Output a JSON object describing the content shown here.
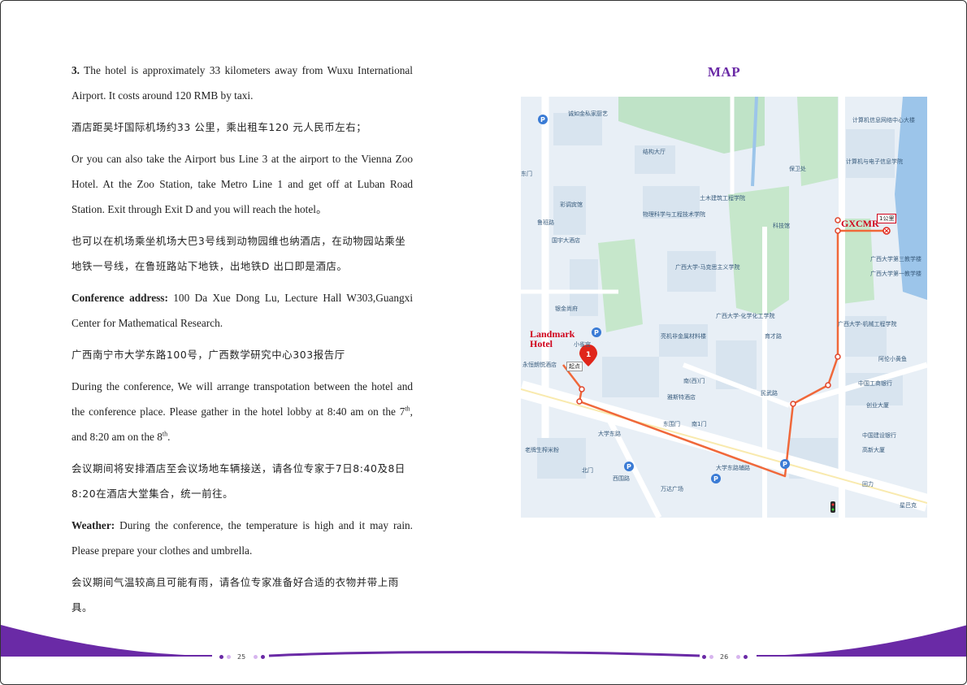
{
  "left": {
    "p1_bold": "3.",
    "p1_text": " The hotel is approximately 33 kilometers away from Wuxu International Airport. It costs around 120 RMB by taxi.",
    "p2_cn": "酒店距吴圩国际机场约33  公里，乘出租车120  元人民币左右；",
    "p3_text": "Or you can also take the Airport bus Line 3 at the airport to the Vienna Zoo Hotel. At the Zoo Station, take Metro Line 1 and get off at Luban Road Station. Exit through Exit D and you will reach the hotel。",
    "p4_cn": "也可以在机场乘坐机场大巴3号线到动物园维也纳酒店，在动物园站乘坐地铁一号线，在鲁班路站下地铁，出地铁D  出口即是酒店。",
    "p5_bold": "Conference address:",
    "p5_text": " 100 Da Xue Dong Lu, Lecture Hall W303,Guangxi Center for Mathematical Research.",
    "p6_cn": "广西南宁市大学东路100号，广西数学研究中心303报告厅",
    "p7_a": "During the conference, We will arrange transpotation between the hotel and the conference place. Please gather in the hotel lobby at 8:40 am on the 7",
    "p7_sup1": "th",
    "p7_b": ", and 8:20 am on the 8",
    "p7_sup2": "th",
    "p7_c": ".",
    "p8_cn": "会议期间将安排酒店至会议场地车辆接送，请各位专家于7日8:40及8日8:20在酒店大堂集合，统一前往。",
    "p9_bold": "Weather:",
    "p9_text": " During the conference, the temperature is high and it may rain. Please prepare your clothes and umbrella.",
    "p10_cn": "会议期间气温较高且可能有雨，请各位专家准备好合适的衣物并带上雨具。"
  },
  "map": {
    "title": "MAP",
    "hotel_label_1": "Landmark",
    "hotel_label_2": "Hotel",
    "dest_label": "GXCMR",
    "distance_label": "1公里",
    "start_label": "起点",
    "start_number": "1",
    "places": [
      "诚如金私家厨艺",
      "结构大厅",
      "保卫处",
      "计算机信息网络中心大楼",
      "计算机与电子信息学院",
      "彩调宾馆",
      "物理科学与工程技术学院",
      "土木建筑工程学院",
      "科技馆",
      "广西大学第三教学楼",
      "国宇大酒店",
      "广西大学-马克思主义学院",
      "广西大学第一教学楼",
      "广西大学-化学化工学院",
      "广西大学-机械工程学院",
      "银金尚府",
      "亮机非金属材料楼",
      "小雀宫",
      "阿伦小黄鱼",
      "中国工商银行",
      "永恒朗悦酒店",
      "南(西)门",
      "雅斯特酒店",
      "创业大厦",
      "东围门",
      "南1门",
      "中国建设银行",
      "高新大厦",
      "老牌生榨米粉",
      "北门",
      "万达广场",
      "回力",
      "大学东路",
      "大学东路辅路",
      "星巴克",
      "鲁班路",
      "西围路",
      "民武路",
      "育才路",
      "东门"
    ]
  },
  "footer": {
    "page_left": "25",
    "page_right": "26"
  },
  "colors": {
    "accent_purple": "#6a2aa6",
    "route_orange": "#f0683a",
    "label_red": "#d0021b"
  }
}
